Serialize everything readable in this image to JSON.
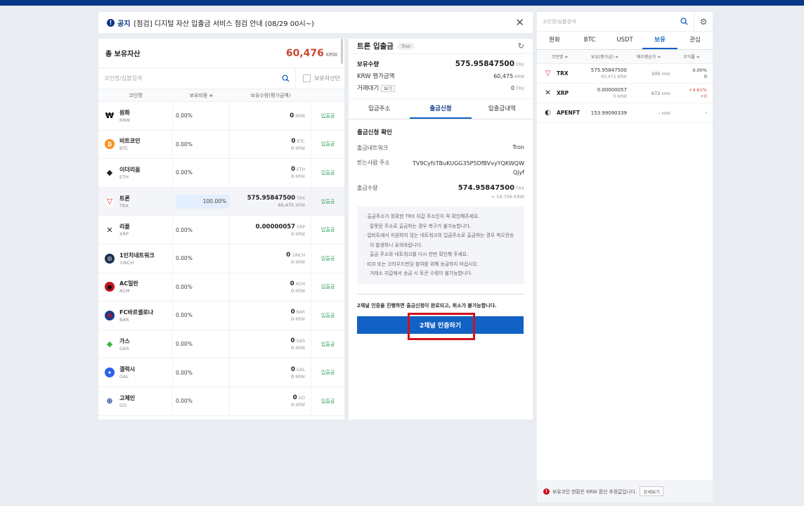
{
  "notice": {
    "tag": "공지",
    "text": "[점검] 디지털 자산 입출금 서비스 점검 안내 (08/29 00시~)",
    "close": "✕"
  },
  "holdings": {
    "total_label": "총 보유자산",
    "total_value": "60,476",
    "total_unit": "KRW",
    "search_placeholder": "코인명/심볼검색",
    "only_held_label": "보유자산만",
    "columns": [
      "코인명",
      "보유비중 ≑",
      "보유수량(평가금액)"
    ],
    "rows": [
      {
        "name": "원화",
        "sym": "KRW",
        "pct": "0.00%",
        "amt": "0",
        "amt_unit": "KRW",
        "krw": "",
        "action": "입출금",
        "icon": "krw-icon",
        "glyph": "₩",
        "color": "#ffffff",
        "fg": "#000"
      },
      {
        "name": "비트코인",
        "sym": "BTC",
        "pct": "0.00%",
        "amt": "0",
        "amt_unit": "BTC",
        "krw": "0",
        "action": "입출금",
        "icon": "bitcoin-icon",
        "glyph": "₿",
        "color": "#f7931a",
        "fg": "#fff"
      },
      {
        "name": "이더리움",
        "sym": "ETH",
        "pct": "0.00%",
        "amt": "0",
        "amt_unit": "ETH",
        "krw": "0",
        "action": "입출금",
        "icon": "ethereum-icon",
        "glyph": "◆",
        "color": "#ffffff",
        "fg": "#222"
      },
      {
        "name": "트론",
        "sym": "TRX",
        "pct": "100.00%",
        "amt": "575.95847500",
        "amt_unit": "TRX",
        "krw": "60,475",
        "action": "입출금",
        "icon": "tron-icon",
        "glyph": "▽",
        "color": "#ffffff",
        "fg": "#e0282e",
        "selected": true
      },
      {
        "name": "리플",
        "sym": "XRP",
        "pct": "0.00%",
        "amt": "0.00000057",
        "amt_unit": "XRP",
        "krw": "0",
        "action": "입출금",
        "icon": "xrp-icon",
        "glyph": "✕",
        "color": "#ffffff",
        "fg": "#222"
      },
      {
        "name": "1인치네트워크",
        "sym": "1INCH",
        "pct": "0.00%",
        "amt": "0",
        "amt_unit": "1INCH",
        "krw": "0",
        "action": "입출금",
        "icon": "1inch-icon",
        "glyph": "◎",
        "color": "#1b314f",
        "fg": "#fff"
      },
      {
        "name": "AC밀란",
        "sym": "ACM",
        "pct": "0.00%",
        "amt": "0",
        "amt_unit": "ACM",
        "krw": "0",
        "action": "입출금",
        "icon": "ac-milan-icon",
        "glyph": "●",
        "color": "#c4121a",
        "fg": "#111"
      },
      {
        "name": "FC바르셀로나",
        "sym": "BAR",
        "pct": "0.00%",
        "amt": "0",
        "amt_unit": "BAR",
        "krw": "0",
        "action": "입출금",
        "icon": "fc-barcelona-icon",
        "glyph": "◉",
        "color": "#1b3c8a",
        "fg": "#c4121a"
      },
      {
        "name": "가스",
        "sym": "GAS",
        "pct": "0.00%",
        "amt": "0",
        "amt_unit": "GAS",
        "krw": "0",
        "action": "입출금",
        "icon": "gas-icon",
        "glyph": "◆",
        "color": "#ffffff",
        "fg": "#3ab54a"
      },
      {
        "name": "갤럭시",
        "sym": "GAL",
        "pct": "0.00%",
        "amt": "0",
        "amt_unit": "GAL",
        "krw": "0",
        "action": "입출금",
        "icon": "galxe-icon",
        "glyph": "✦",
        "color": "#2c62e8",
        "fg": "#fff"
      },
      {
        "name": "고체인",
        "sym": "GO",
        "pct": "0.00%",
        "amt": "0",
        "amt_unit": "GO",
        "krw": "0",
        "action": "입출금",
        "icon": "gochain-icon",
        "glyph": "⊕",
        "color": "#ffffff",
        "fg": "#1a3d8f"
      }
    ]
  },
  "detail": {
    "title": "트론 입출금",
    "badge": "Tron",
    "held_label": "보유수량",
    "held_value": "575.95847500",
    "held_unit": "TRX",
    "krw_label": "KRW 평가금액",
    "krw_value": "60,475",
    "krw_unit": "KRW",
    "pending_label": "거래대기",
    "pending_btn": "보기",
    "pending_value": "0",
    "pending_unit": "TRX",
    "tabs": [
      "입금주소",
      "출금신청",
      "입출금내역"
    ],
    "form_title": "출금신청 확인",
    "network_label": "출금네트워크",
    "network_value": "Tron",
    "address_label": "받는사람 주소",
    "address_value": "TV9CyfsTBuKUGG35P5DfBVvyYQKWQWQjyf",
    "amount_label": "출금수량",
    "amount_value": "574.95847500",
    "amount_unit": "TRX",
    "amount_krw": "≈ 59,796 KRW",
    "notes": [
      "·  출금주소가 정확한 TRX 지갑 주소인지 꼭 확인해주세요.",
      "잘못된 주소로 출금하는 경우 복구가 불가능합니다.",
      "·  업비트에서 지원하지 않는 네트워크의 입금주소로 출금하는 경우 착오전송이 발생하니 유의바랍니다.",
      "출금 주소와 네트워크를 다시 한번 확인해 주세요.",
      "·  ICO 또는 크라우드펀딩 참여를 위해 송금하지 마십시오.",
      "거래소 지갑에서 송금 시 토큰 수령이 불가능합니다."
    ],
    "warning": "2채널 인증을 진행하면 출금신청이 완료되고, 취소가 불가능합니다.",
    "auth_button": "2채널 인증하기"
  },
  "market": {
    "search_placeholder": "코인명/심볼검색",
    "tabs": [
      "원화",
      "BTC",
      "USDT",
      "보유",
      "관심"
    ],
    "columns": [
      "코인명 ≑",
      "보유(평가금) ≑",
      "매수평균가 ≑",
      "수익률 ≑"
    ],
    "rows": [
      {
        "name": "TRX",
        "hold": "575.95847500",
        "hold_krw": "60,475 KRW",
        "avg": "105",
        "avg_unit": "KRW",
        "pnl": "0.00%",
        "pnl2": "0",
        "red": false,
        "icon": "tron-icon",
        "glyph": "▽",
        "fg": "#e0282e"
      },
      {
        "name": "XRP",
        "hold": "0.00000057",
        "hold_krw": "0 KRW",
        "avg": "672",
        "avg_unit": "KRW",
        "pnl": "+4.61%",
        "pnl2": "+0",
        "red": true,
        "icon": "xrp-icon",
        "glyph": "✕",
        "fg": "#222"
      },
      {
        "name": "APENFT",
        "hold": "153.99090339",
        "hold_krw": "",
        "avg": "-",
        "avg_unit": "KRW",
        "pnl": "-",
        "pnl2": "",
        "red": false,
        "icon": "apenft-icon",
        "glyph": "◐",
        "fg": "#333"
      }
    ],
    "footer_text": "보유코인 현황은 KRW 환산 추정값입니다.",
    "footer_btn": "상세보기"
  }
}
